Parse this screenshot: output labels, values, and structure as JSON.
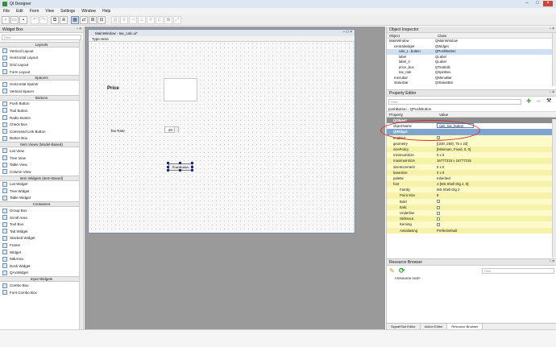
{
  "app": {
    "title": "Qt Designer"
  },
  "menu": [
    "File",
    "Edit",
    "Form",
    "View",
    "Settings",
    "Window",
    "Help"
  ],
  "widget_box": {
    "title": "Widget Box",
    "filter_placeholder": "Filter",
    "categories": [
      {
        "name": "Layouts",
        "items": [
          "Vertical Layout",
          "Horizontal Layout",
          "Grid Layout",
          "Form Layout"
        ]
      },
      {
        "name": "Spacers",
        "items": [
          "Horizontal Spacer",
          "Vertical Spacer"
        ]
      },
      {
        "name": "Buttons",
        "items": [
          "Push Button",
          "Tool Button",
          "Radio Button",
          "Check Box",
          "Command Link Button",
          "Button Box"
        ]
      },
      {
        "name": "Item Views (Model-Based)",
        "items": [
          "List View",
          "Tree View",
          "Table View",
          "Column View"
        ]
      },
      {
        "name": "Item Widgets (Item-Based)",
        "items": [
          "List Widget",
          "Tree Widget",
          "Table Widget"
        ]
      },
      {
        "name": "Containers",
        "items": [
          "Group Box",
          "Scroll Area",
          "Tool Box",
          "Tab Widget",
          "Stacked Widget",
          "Frame",
          "Widget",
          "MdiArea",
          "Dock Widget",
          "QAxWidget"
        ]
      },
      {
        "name": "Input Widgets",
        "items": [
          "Combo Box",
          "Font Combo Box"
        ]
      }
    ]
  },
  "form_window": {
    "title": "MainWindow - tax_calc.ui*",
    "menu_placeholder": "Type Here",
    "price_label": "Price",
    "tax_rate_label": "Tax Rate",
    "tax_rate_value": "20",
    "push_button_label": "PushButton"
  },
  "object_inspector": {
    "title": "Object Inspector",
    "columns": [
      "Object",
      "Class"
    ],
    "rows": [
      {
        "object": "MainWindow",
        "class": "QMainWindow",
        "indent": 0
      },
      {
        "object": "centralwidget",
        "class": "QWidget",
        "indent": 1
      },
      {
        "object": "calc_t...button",
        "class": "QPushButton",
        "indent": 2
      },
      {
        "object": "label",
        "class": "QLabel",
        "indent": 2
      },
      {
        "object": "label_2",
        "class": "QLabel",
        "indent": 2
      },
      {
        "object": "price_box",
        "class": "QTextEdit",
        "indent": 2
      },
      {
        "object": "tax_rate",
        "class": "QSpinBox",
        "indent": 2
      },
      {
        "object": "menubar",
        "class": "QMenuBar",
        "indent": 1
      },
      {
        "object": "statusbar",
        "class": "QStatusBar",
        "indent": 1
      }
    ]
  },
  "property_editor": {
    "title": "Property Editor",
    "filter_placeholder": "Filter",
    "object_line": "pushButton : QPushButton",
    "columns": [
      "Property",
      "Value"
    ],
    "rows": [
      {
        "property": "QObject",
        "value": "",
        "kind": "cathead"
      },
      {
        "property": "objectName",
        "value": "calc_tax_button",
        "kind": "edit"
      },
      {
        "property": "QWidget",
        "value": "",
        "kind": "catblue"
      },
      {
        "property": "enabled",
        "value": "",
        "kind": "check"
      },
      {
        "property": "geometry",
        "value": "[(230, 250), 75 x 23]",
        "kind": "y1"
      },
      {
        "property": "sizePolicy",
        "value": "[Minimum, Fixed, 0, 0]",
        "kind": "y2"
      },
      {
        "property": "minimumSize",
        "value": "0 x 0",
        "kind": "y1"
      },
      {
        "property": "maximumSize",
        "value": "16777215 x 16777215",
        "kind": "y2"
      },
      {
        "property": "sizeIncrement",
        "value": "0 x 0",
        "kind": "y1"
      },
      {
        "property": "baseSize",
        "value": "0 x 0",
        "kind": "y2"
      },
      {
        "property": "palette",
        "value": "Inherited",
        "kind": "y1"
      },
      {
        "property": "font",
        "value": "A  [MS Shell Dlg 2, 8]",
        "kind": "y2"
      },
      {
        "property": "Family",
        "value": "MS Shell Dlg 2",
        "kind": "y1"
      },
      {
        "property": "Point Size",
        "value": "8",
        "kind": "y2"
      },
      {
        "property": "Bold",
        "value": "",
        "kind": "check-off"
      },
      {
        "property": "Italic",
        "value": "",
        "kind": "check-off2"
      },
      {
        "property": "Underline",
        "value": "",
        "kind": "check-off"
      },
      {
        "property": "Strikeout",
        "value": "",
        "kind": "check-off2"
      },
      {
        "property": "Kerning",
        "value": "",
        "kind": "check-on"
      },
      {
        "property": "Antialiasing",
        "value": "PreferDefault",
        "kind": "y2"
      }
    ]
  },
  "resource_browser": {
    "title": "Resource Browser",
    "filter_placeholder": "Filter",
    "root": "<resource root>",
    "tabs": [
      "Signal/Slot Editor",
      "Action Editor",
      "Resource Browser"
    ],
    "active_tab": 2
  }
}
